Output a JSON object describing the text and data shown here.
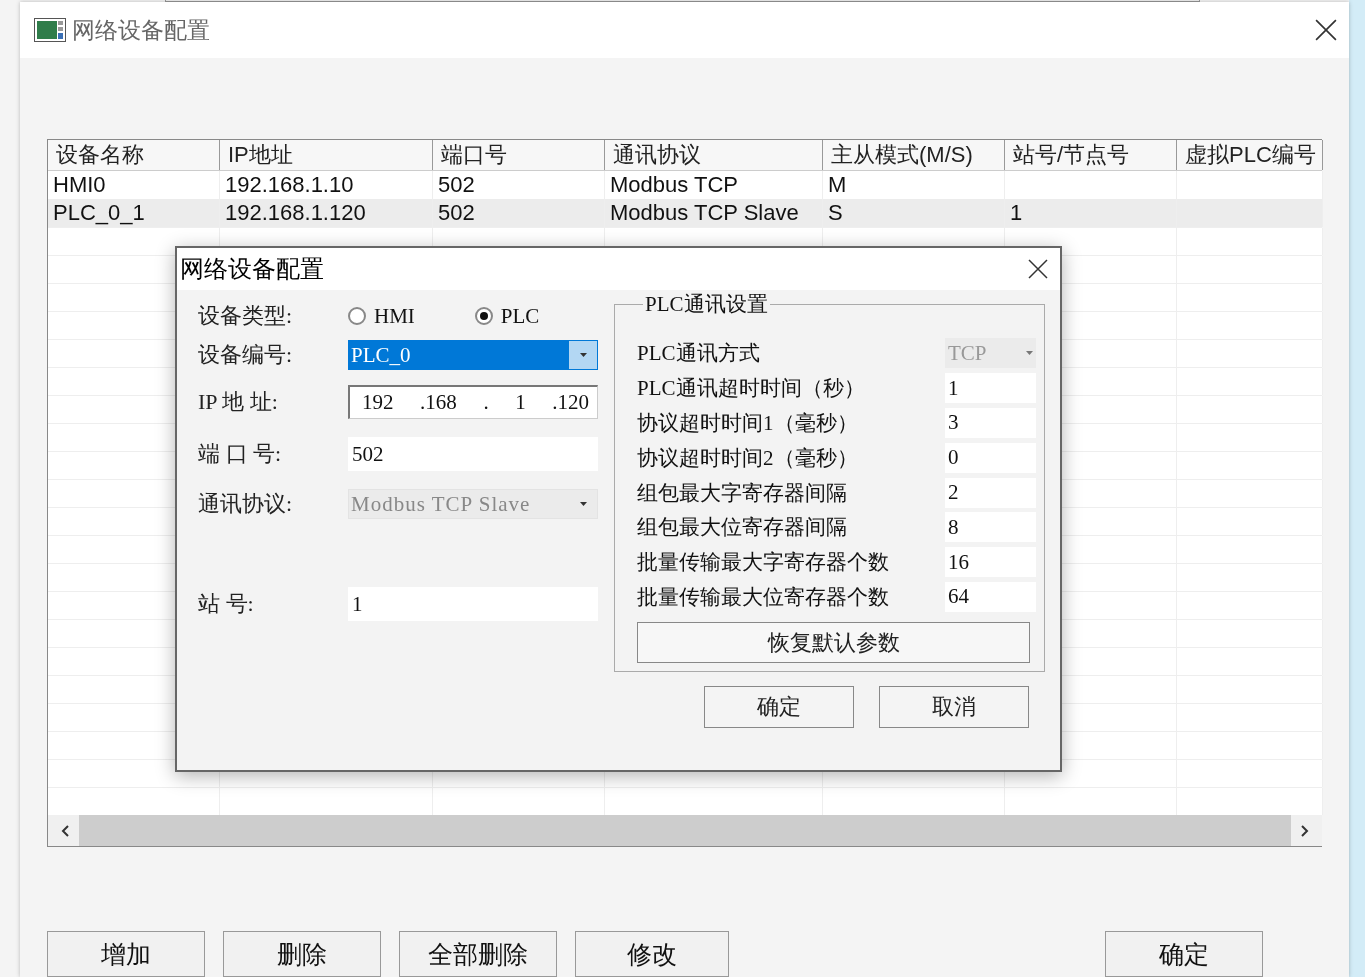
{
  "window": {
    "title": "网络设备配置"
  },
  "table": {
    "columns": [
      "设备名称",
      "IP地址",
      "端口号",
      "通讯协议",
      "主从模式(M/S)",
      "站号/节点号",
      "虚拟PLC编号"
    ],
    "rows": [
      {
        "selected": false,
        "cells": [
          "HMI0",
          "192.168.1.10",
          "502",
          "Modbus TCP",
          "M",
          "",
          ""
        ]
      },
      {
        "selected": true,
        "cells": [
          "PLC_0_1",
          "192.168.1.120",
          "502",
          "Modbus TCP Slave",
          "S",
          "1",
          ""
        ]
      }
    ]
  },
  "buttons": [
    {
      "label": "增加"
    },
    {
      "label": "删除"
    },
    {
      "label": "全部删除"
    },
    {
      "label": "修改"
    }
  ],
  "confirm_button": {
    "label": "确定"
  },
  "dialog": {
    "title": "网络设备配置",
    "device_type": {
      "label": "设备类型:",
      "options": [
        {
          "label": "HMI",
          "selected": false
        },
        {
          "label": "PLC",
          "selected": true
        }
      ]
    },
    "fields": [
      {
        "kind": "combo",
        "label": "设备编号:",
        "value": "PLC_0",
        "highlighted": true,
        "disabled": false
      },
      {
        "kind": "ip",
        "label": "IP 地 址:",
        "parts": [
          "192",
          ".168",
          ".",
          "1",
          ".120"
        ]
      },
      {
        "kind": "text",
        "label": "端 口 号:",
        "value": "502"
      },
      {
        "kind": "combo",
        "label": "通讯协议:",
        "value": "Modbus TCP Slave",
        "highlighted": false,
        "disabled": true
      }
    ],
    "station_field": {
      "kind": "text",
      "label": "站 号:",
      "value": "1"
    },
    "group": {
      "title": "PLC通讯设置",
      "rows": [
        {
          "kind": "combo",
          "label": "PLC通讯方式",
          "value": "TCP",
          "disabled": true
        },
        {
          "kind": "text",
          "label": "PLC通讯超时时间（秒）",
          "value": "1"
        },
        {
          "kind": "text",
          "label": "协议超时时间1（毫秒）",
          "value": "3"
        },
        {
          "kind": "text",
          "label": "协议超时时间2（毫秒）",
          "value": "0"
        },
        {
          "kind": "text",
          "label": "组包最大字寄存器间隔",
          "value": "2"
        },
        {
          "kind": "text",
          "label": "组包最大位寄存器间隔",
          "value": "8"
        },
        {
          "kind": "text",
          "label": "批量传输最大字寄存器个数",
          "value": "16"
        },
        {
          "kind": "text",
          "label": "批量传输最大位寄存器个数",
          "value": "64"
        }
      ],
      "reset_button": {
        "label": "恢复默认参数"
      }
    },
    "buttons": [
      {
        "label": "确定"
      },
      {
        "label": "取消"
      }
    ]
  }
}
